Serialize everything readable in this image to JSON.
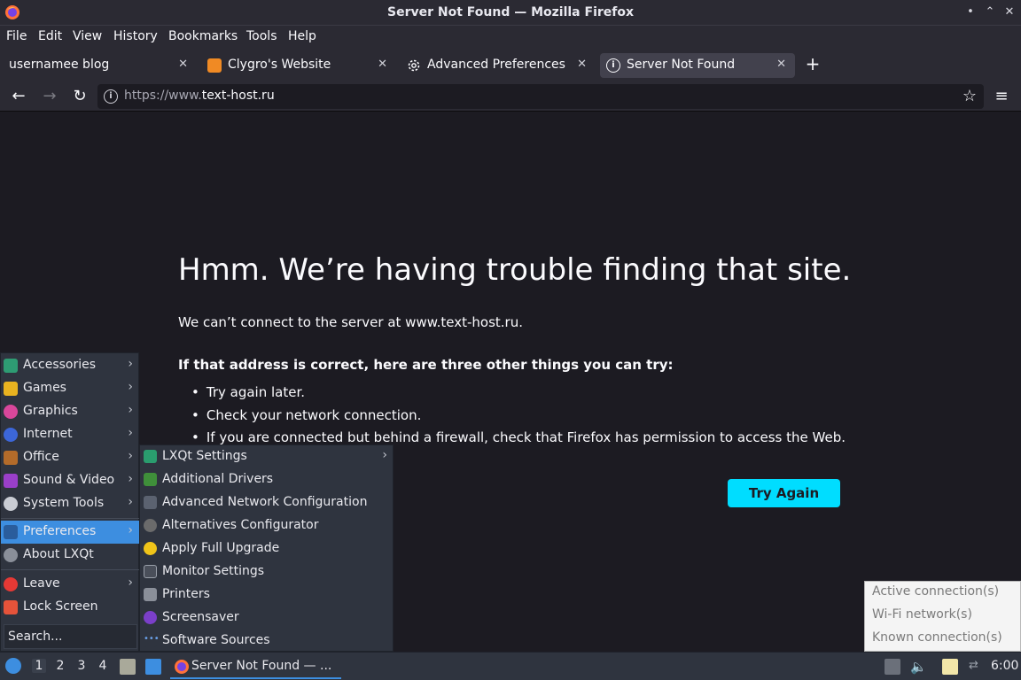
{
  "window": {
    "title": "Server Not Found — Mozilla Firefox",
    "minimize": "•",
    "maximize": "⌃",
    "close": "✕"
  },
  "menubar": {
    "items": [
      "File",
      "Edit",
      "View",
      "History",
      "Bookmarks",
      "Tools",
      "Help"
    ]
  },
  "tabs": [
    {
      "label": "usernamee blog",
      "close": "✕"
    },
    {
      "label": "Clygro's Website",
      "close": "✕"
    },
    {
      "label": "Advanced Preferences",
      "close": "✕"
    },
    {
      "label": "Server Not Found",
      "close": "✕"
    }
  ],
  "newtab": "+",
  "nav": {
    "back": "←",
    "forward": "→",
    "reload": "↻",
    "url_prefix": "https://www.",
    "url_host": "text-host.ru",
    "bookmark": "☆",
    "menu": "≡"
  },
  "error": {
    "title": "Hmm. We’re having trouble finding that site.",
    "description": "We can’t connect to the server at www.text-host.ru.",
    "subtitle": "If that address is correct, here are three other things you can try:",
    "items": [
      "Try again later.",
      "Check your network connection.",
      "If you are connected but behind a firewall, check that Firefox has permission to access the Web."
    ],
    "button": "Try Again"
  },
  "startmenu": {
    "items": [
      {
        "label": "Accessories",
        "arrow": "›"
      },
      {
        "label": "Games",
        "arrow": "›"
      },
      {
        "label": "Graphics",
        "arrow": "›"
      },
      {
        "label": "Internet",
        "arrow": "›"
      },
      {
        "label": "Office",
        "arrow": "›"
      },
      {
        "label": "Sound & Video",
        "arrow": "›"
      },
      {
        "label": "System Tools",
        "arrow": "›"
      },
      {
        "label": "Preferences",
        "arrow": "›"
      },
      {
        "label": "About LXQt"
      },
      {
        "label": "Leave",
        "arrow": "›"
      },
      {
        "label": "Lock Screen"
      }
    ],
    "search_placeholder": "Search..."
  },
  "submenu": {
    "items": [
      {
        "label": "LXQt Settings",
        "arrow": "›"
      },
      {
        "label": "Additional Drivers"
      },
      {
        "label": "Advanced Network Configuration"
      },
      {
        "label": "Alternatives Configurator"
      },
      {
        "label": "Apply Full Upgrade"
      },
      {
        "label": "Monitor Settings"
      },
      {
        "label": "Printers"
      },
      {
        "label": "Screensaver"
      },
      {
        "label": "Software Sources"
      }
    ]
  },
  "network_popup": {
    "items": [
      "Active connection(s)",
      "Wi-Fi network(s)",
      "Known connection(s)"
    ]
  },
  "taskbar": {
    "workspaces": [
      "1",
      "2",
      "3",
      "4"
    ],
    "task_label": "Server Not Found — ...",
    "clock": "6:00"
  },
  "colors": {
    "accent": "#00ddff",
    "selection": "#3d8ee0",
    "background": "#1c1b22"
  }
}
